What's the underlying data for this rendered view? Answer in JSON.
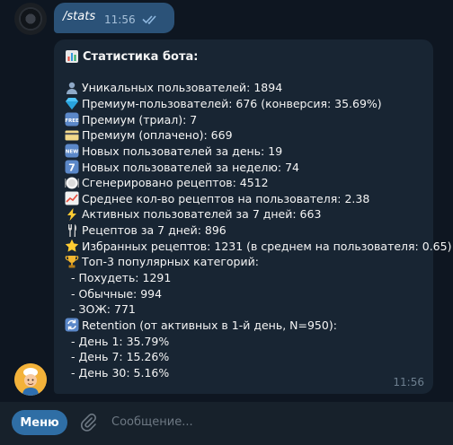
{
  "outgoing": {
    "text": "/stats",
    "time": "11:56",
    "status": "read"
  },
  "incoming": {
    "title_icon": "bar-chart-icon",
    "title": "Статистика бота:",
    "time": "11:56",
    "lines": [
      {
        "icon": "user-icon",
        "text": "Уникальных пользователей: 1894"
      },
      {
        "icon": "gem-icon",
        "text": "Премиум-пользователей: 676 (конверсия: 35.69%)"
      },
      {
        "icon": "free-icon",
        "text": "Премиум (триал): 7"
      },
      {
        "icon": "credit-card-icon",
        "text": "Премиум (оплачено): 669"
      },
      {
        "icon": "new-icon",
        "text": "Новых пользователей за день: 19"
      },
      {
        "icon": "seven-icon",
        "text": "Новых пользователей за неделю: 74"
      },
      {
        "icon": "plate-icon",
        "text": "Сгенерировано рецептов: 4512"
      },
      {
        "icon": "chart-up-icon",
        "text": "Среднее кол-во рецептов на пользователя: 2.38"
      },
      {
        "icon": "lightning-icon",
        "text": "Активных пользователей за 7 дней: 663"
      },
      {
        "icon": "fork-knife-icon",
        "text": "Рецептов за 7 дней: 896"
      },
      {
        "icon": "star-icon",
        "text": "Избранных рецептов: 1231 (в среднем на пользователя: 0.65)"
      },
      {
        "icon": "trophy-icon",
        "text": "Топ-3 популярных категорий:"
      },
      {
        "icon": "",
        "text": "- Похудеть: 1291"
      },
      {
        "icon": "",
        "text": "- Обычные: 994"
      },
      {
        "icon": "",
        "text": "- ЗОЖ: 771"
      },
      {
        "icon": "refresh-icon",
        "text": "Retention (от активных в 1-й день, N=950):"
      },
      {
        "icon": "",
        "text": "- День 1: 35.79%"
      },
      {
        "icon": "",
        "text": "- День 7: 15.26%"
      },
      {
        "icon": "",
        "text": "- День 30: 5.16%"
      }
    ]
  },
  "input_bar": {
    "menu_label": "Меню",
    "placeholder": "Сообщение..."
  },
  "colors": {
    "background": "#0e1621",
    "outgoing_bubble": "#2b5278",
    "incoming_bubble": "#182533",
    "menu_button": "#2f6ea5"
  }
}
